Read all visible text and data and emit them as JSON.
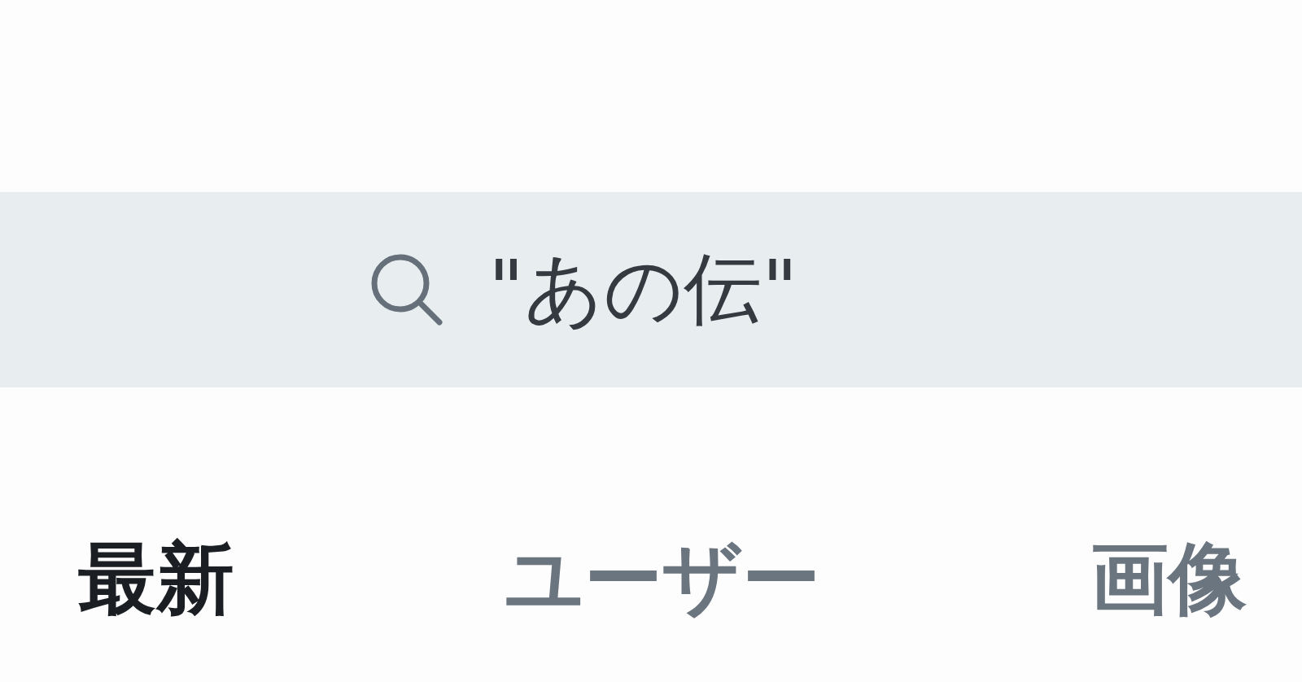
{
  "search": {
    "value": "\"あの伝\""
  },
  "tabs": [
    {
      "label": "最新",
      "selected": true
    },
    {
      "label": "ユーザー",
      "selected": false
    },
    {
      "label": "画像",
      "selected": false
    }
  ]
}
